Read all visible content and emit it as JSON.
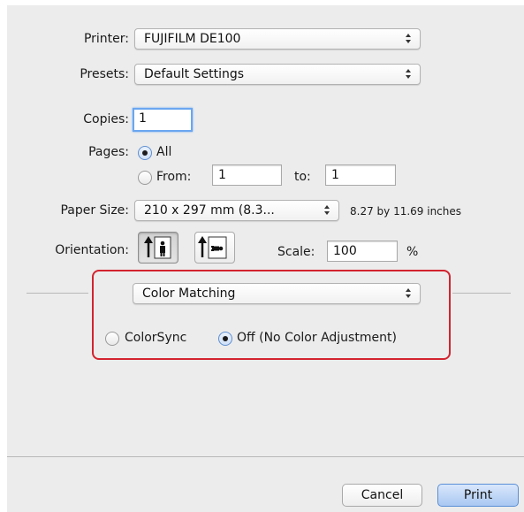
{
  "printer": {
    "label": "Printer:",
    "value": "FUJIFILM DE100"
  },
  "presets": {
    "label": "Presets:",
    "value": "Default Settings"
  },
  "copies": {
    "label": "Copies:",
    "value": "1"
  },
  "pages": {
    "label": "Pages:",
    "all_label": "All",
    "from_label": "From:",
    "from_value": "1",
    "to_label": "to:",
    "to_value": "1",
    "selected": "All"
  },
  "paper_size": {
    "label": "Paper Size:",
    "value": "210 x 297 mm (8.3...",
    "dimensions": "8.27 by 11.69 inches"
  },
  "orientation": {
    "label": "Orientation:",
    "selected": "portrait"
  },
  "scale": {
    "label": "Scale:",
    "value": "100",
    "unit": "%"
  },
  "section": {
    "value": "Color Matching"
  },
  "color_matching": {
    "option_colorsync": "ColorSync",
    "option_off": "Off (No Color Adjustment)",
    "selected": "off"
  },
  "buttons": {
    "cancel": "Cancel",
    "print": "Print"
  },
  "colors": {
    "highlight": "#d3232f",
    "accent": "#5a8fd6",
    "panel": "#ececec"
  }
}
